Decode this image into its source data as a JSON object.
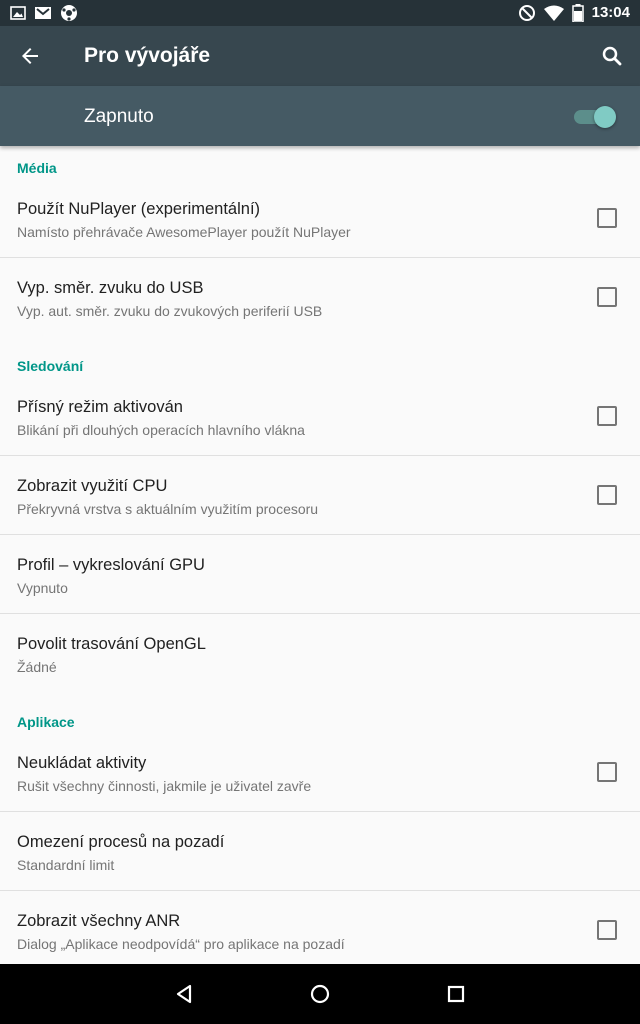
{
  "status_bar": {
    "time": "13:04",
    "left_icons": [
      "image-icon",
      "gmail-icon",
      "soccer-ball-icon"
    ],
    "right_icons": [
      "do-not-disturb-icon",
      "wifi-icon",
      "battery-icon"
    ]
  },
  "app_bar": {
    "title": "Pro vývojáře",
    "back_icon": "arrow-back-icon",
    "search_icon": "search-icon"
  },
  "switch_bar": {
    "label": "Zapnuto",
    "state": "on",
    "accent": "#80cbc4"
  },
  "sections": {
    "media": {
      "header": "Média",
      "items": [
        {
          "title": "Použít NuPlayer (experimentální)",
          "summary": "Namísto přehrávače AwesomePlayer použít NuPlayer",
          "checked": false
        },
        {
          "title": "Vyp. směr. zvuku do USB",
          "summary": "Vyp. aut. směr. zvuku do zvukových periferií USB",
          "checked": false
        }
      ]
    },
    "monitoring": {
      "header": "Sledování",
      "items": [
        {
          "title": "Přísný režim aktivován",
          "summary": "Blikání při dlouhých operacích hlavního vlákna",
          "checked": false
        },
        {
          "title": "Zobrazit využití CPU",
          "summary": "Překryvná vrstva s aktuálním využitím procesoru",
          "checked": false
        },
        {
          "title": "Profil – vykreslování GPU",
          "summary": "Vypnuto"
        },
        {
          "title": "Povolit trasování OpenGL",
          "summary": "Žádné"
        }
      ]
    },
    "apps": {
      "header": "Aplikace",
      "items": [
        {
          "title": "Neukládat aktivity",
          "summary": "Rušit všechny činnosti, jakmile je uživatel zavře",
          "checked": false
        },
        {
          "title": "Omezení procesů na pozadí",
          "summary": "Standardní limit"
        },
        {
          "title": "Zobrazit všechny ANR",
          "summary": "Dialog „Aplikace neodpovídá“ pro aplikace na pozadí",
          "checked": false
        }
      ]
    }
  },
  "colors": {
    "status_bar": "#263238",
    "app_bar": "#37474f",
    "switch_bar": "#455a64",
    "category": "#009688"
  },
  "nav_bar": {
    "icons": [
      "back-triangle-icon",
      "home-circle-icon",
      "recents-square-icon"
    ]
  }
}
